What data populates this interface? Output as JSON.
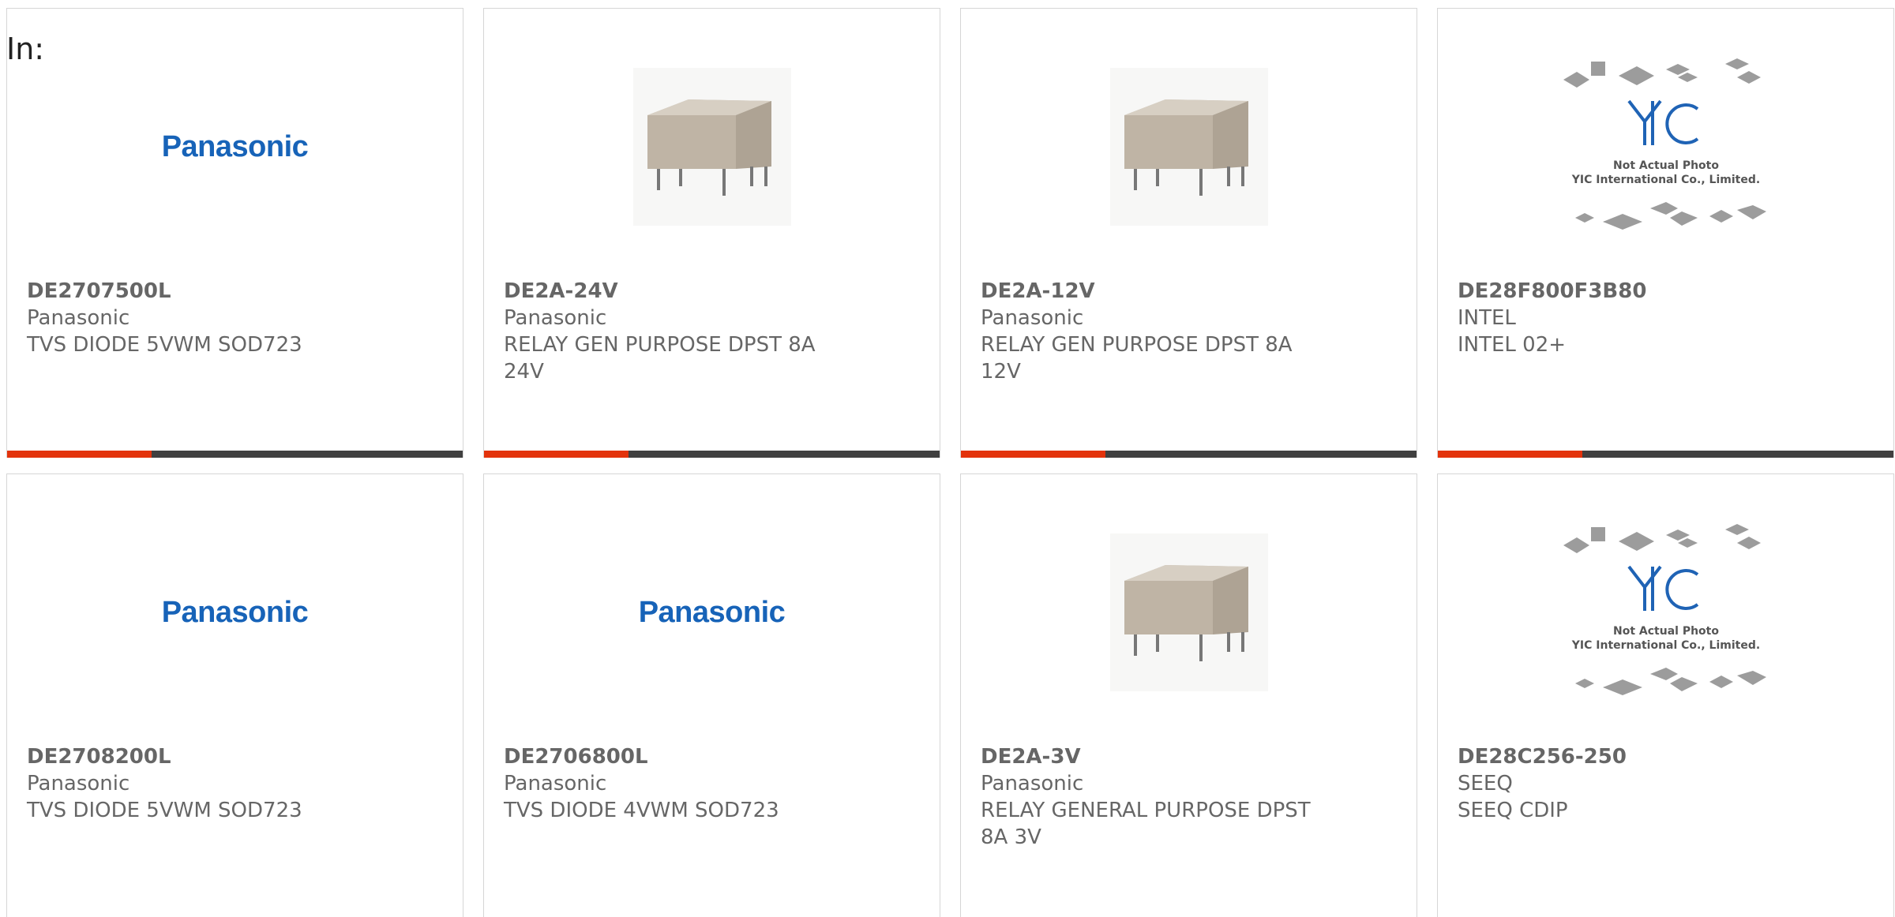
{
  "header": {
    "label": "In:"
  },
  "brand_logo_text": "Panasonic",
  "yic_placeholder": {
    "logo_text": "YIC",
    "line1": "Not Actual Photo",
    "line2": "YIC International Co., Limited."
  },
  "colors": {
    "accent": "#e3330c",
    "bar": "#404040",
    "logo_blue": "#1763b8",
    "text": "#666666"
  },
  "products": [
    {
      "part": "DE2707500L",
      "maker": "Panasonic",
      "desc": "TVS DIODE 5VWM SOD723",
      "image": "panasonic-logo"
    },
    {
      "part": "DE2A-24V",
      "maker": "Panasonic",
      "desc": "RELAY GEN PURPOSE DPST 8A 24V",
      "image": "relay-photo"
    },
    {
      "part": "DE2A-12V",
      "maker": "Panasonic",
      "desc": "RELAY GEN PURPOSE DPST 8A 12V",
      "image": "relay-photo"
    },
    {
      "part": "DE28F800F3B80",
      "maker": "INTEL",
      "desc": "INTEL 02+",
      "image": "yic-placeholder"
    },
    {
      "part": "DE2708200L",
      "maker": "Panasonic",
      "desc": "TVS DIODE 5VWM SOD723",
      "image": "panasonic-logo"
    },
    {
      "part": "DE2706800L",
      "maker": "Panasonic",
      "desc": "TVS DIODE 4VWM SOD723",
      "image": "panasonic-logo"
    },
    {
      "part": "DE2A-3V",
      "maker": "Panasonic",
      "desc": "RELAY GENERAL PURPOSE DPST 8A 3V",
      "image": "relay-photo"
    },
    {
      "part": "DE28C256-250",
      "maker": "SEEQ",
      "desc": "SEEQ CDIP",
      "image": "yic-placeholder"
    }
  ]
}
